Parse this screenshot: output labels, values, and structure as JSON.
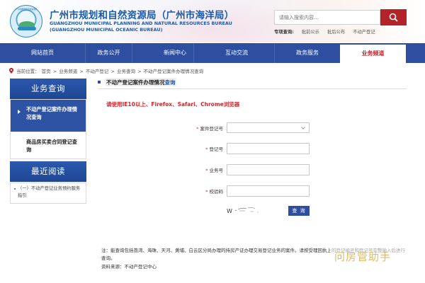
{
  "header": {
    "logo_text": "广州市规划和自然资源局",
    "title_zh": "广州市规划和自然资源局（广州市海洋局）",
    "title_en_line1": "GUANGZHOU MUNICIPAL PLANNING AND NATURAL RESOURCES BUREAU",
    "title_en_line2": "(GUANGZHOU MUNICIPAL OCEANIC BUREAU)",
    "search_placeholder": "请输入搜索内容...",
    "search_icon": "search-icon",
    "special_label": "专项查询:",
    "special_links": [
      "批前公示",
      "批后公布",
      "不动产登记"
    ]
  },
  "nav": {
    "items": [
      "网站首页",
      "政务公开",
      "新闻中心",
      "互动交流",
      "政务服务",
      "业务频道"
    ],
    "active_index": 5
  },
  "breadcrumb": {
    "prefix": "当前位置：",
    "items": [
      "首页",
      "业务频道",
      "不动产登记",
      "业务查询",
      "不动产登记案件办理情况查询"
    ],
    "separator": ">"
  },
  "sidebar": {
    "section1_title": "业务查询",
    "items": [
      {
        "label": "不动产登记案件办理情况查询",
        "active": true
      },
      {
        "label": "商品房买卖合同登记查询",
        "active": false
      }
    ],
    "section2_title": "最近阅读",
    "recent": [
      "（一）不动产登记业务预约服务指引"
    ]
  },
  "main": {
    "title": "不动产登记案件办理情况",
    "title_suffix": "查询",
    "browser_note": "请使用IE10以上、Firefox、Safari、Chrome浏览器",
    "fields": [
      {
        "label": "案件登记号",
        "required": true,
        "type": "select",
        "value": ""
      },
      {
        "label": "登记号",
        "required": true,
        "type": "text",
        "value": ""
      },
      {
        "label": "业务号",
        "required": true,
        "type": "text",
        "value": ""
      },
      {
        "label": "校验码",
        "required": true,
        "type": "text",
        "value": ""
      }
    ],
    "captcha_text": "W ́-̃-̃",
    "query_button": "查 询",
    "note": "注：能查询包括荔湾、海珠、天河、黄埔、白云区分局办理的持房产证办理交易登记业务的案件。请按受理回执上的登记编号和登记号完整输入后进行查询。",
    "source": "资料来源：不动产登记中心"
  },
  "watermark": "问房管助手",
  "colors": {
    "nav_bg": "#2e4f9f",
    "accent_red": "#c0272d",
    "title_blue": "#1b5aa8",
    "search_button": "#b4232a"
  }
}
